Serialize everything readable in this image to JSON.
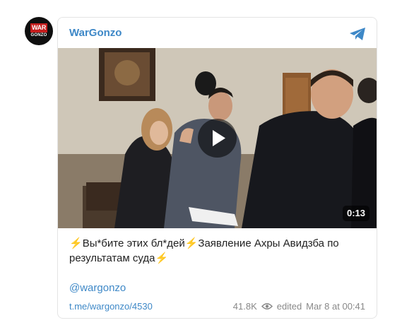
{
  "channel": {
    "name": "WarGonzo",
    "avatar_top": "WAR",
    "avatar_bottom": "GONZO"
  },
  "video": {
    "duration": "0:13"
  },
  "post": {
    "bolt": "⚡",
    "text_part1": "Вы*бите этих бл*дей",
    "text_part2": "Заявление Ахры Авидзба по результатам суда",
    "mention": "@wargonzo",
    "link": "t.me/wargonzo/4530",
    "views": "41.8K",
    "edited_label": "edited",
    "timestamp": "Mar 8 at 00:41"
  },
  "colors": {
    "link": "#3e88c7",
    "bolt": "#f6b300",
    "meta": "#888888"
  },
  "icons": [
    "telegram-plane-icon",
    "play-icon",
    "eye-icon"
  ]
}
